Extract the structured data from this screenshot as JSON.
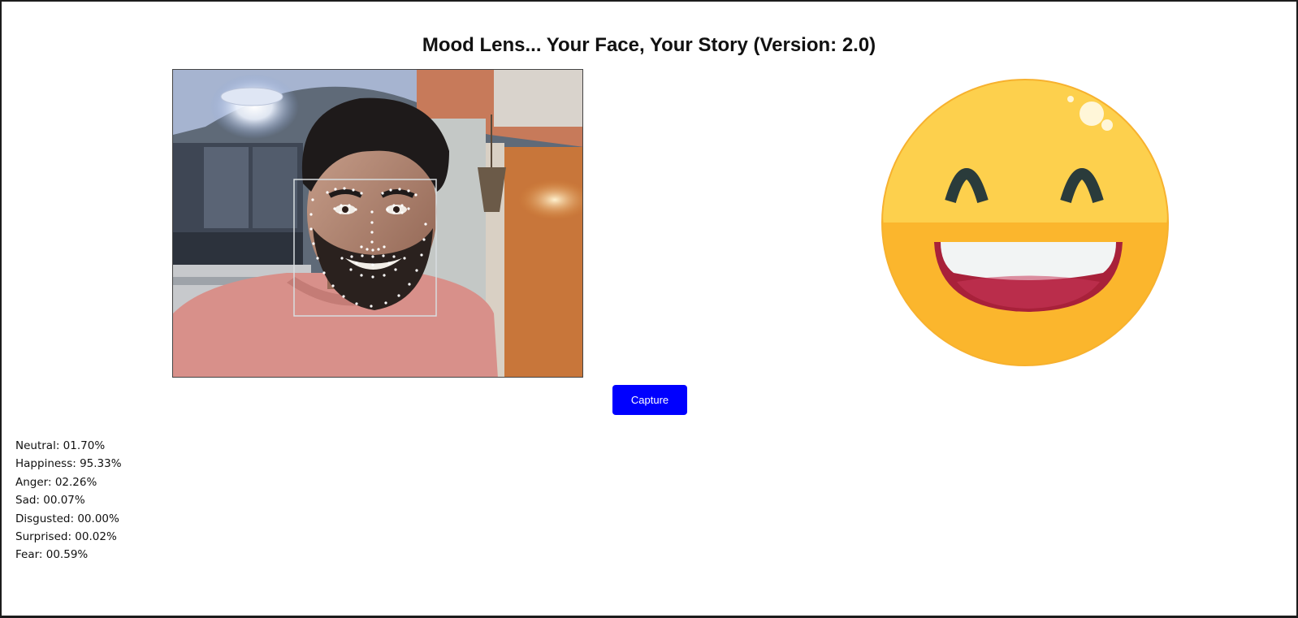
{
  "app": {
    "title": "Mood Lens... Your Face, Your Story (Version: 2.0)"
  },
  "camera": {
    "icon": "webcam-feed"
  },
  "capture_button": {
    "label": "Capture",
    "color": "#0000ff"
  },
  "emoji": {
    "icon": "laughing-face-emoji",
    "face_color": "#fdd04d",
    "mouth_color": "#a8213a"
  },
  "emotions": [
    {
      "label": "Neutral: 01.70%",
      "name": "Neutral",
      "value": 1.7
    },
    {
      "label": "Happiness: 95.33%",
      "name": "Happiness",
      "value": 95.33
    },
    {
      "label": "Anger: 02.26%",
      "name": "Anger",
      "value": 2.26
    },
    {
      "label": "Sad: 00.07%",
      "name": "Sad",
      "value": 0.07
    },
    {
      "label": "Disgusted: 00.00%",
      "name": "Disgusted",
      "value": 0.0
    },
    {
      "label": "Surprised: 00.02%",
      "name": "Surprised",
      "value": 0.02
    },
    {
      "label": "Fear: 00.59%",
      "name": "Fear",
      "value": 0.59
    }
  ]
}
